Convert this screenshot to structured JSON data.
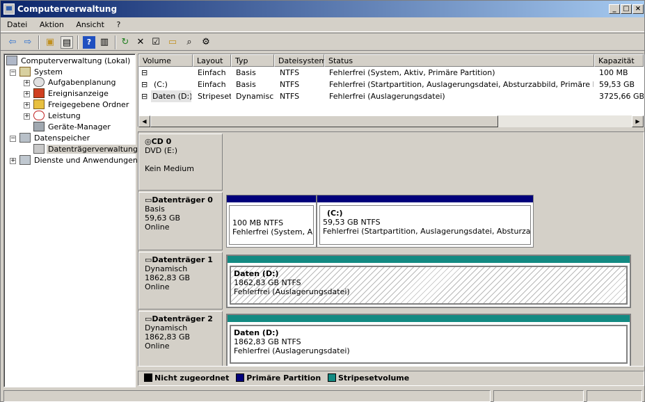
{
  "window": {
    "title": "Computerverwaltung"
  },
  "menu": [
    "Datei",
    "Aktion",
    "Ansicht",
    "?"
  ],
  "tree": {
    "root": "Computerverwaltung (Lokal)",
    "system": "System",
    "aufgaben": "Aufgabenplanung",
    "ereignis": "Ereignisanzeige",
    "freigabe": "Freigegebene Ordner",
    "leistung": "Leistung",
    "geraete": "Geräte-Manager",
    "datenspeicher": "Datenspeicher",
    "datentraeger": "Datenträgerverwaltung",
    "dienste": "Dienste und Anwendungen"
  },
  "columns": [
    "Volume",
    "Layout",
    "Typ",
    "Dateisystem",
    "Status",
    "Kapazität"
  ],
  "volumes": [
    {
      "volume": "",
      "layout": "Einfach",
      "typ": "Basis",
      "fs": "NTFS",
      "status": "Fehlerfrei (System, Aktiv, Primäre Partition)",
      "kap": "100 MB"
    },
    {
      "volume": "(C:)",
      "layout": "Einfach",
      "typ": "Basis",
      "fs": "NTFS",
      "status": "Fehlerfrei (Startpartition, Auslagerungsdatei, Absturzabbild, Primäre Partition)",
      "kap": "59,53 GB"
    },
    {
      "volume": "Daten (D:)",
      "layout": "Stripeset",
      "typ": "Dynamisch",
      "fs": "NTFS",
      "status": "Fehlerfrei (Auslagerungsdatei)",
      "kap": "3725,66 GB"
    }
  ],
  "cd": {
    "name": "CD 0",
    "line1": "DVD (E:)",
    "line2": "Kein Medium"
  },
  "disk0": {
    "name": "Datenträger 0",
    "type": "Basis",
    "size": "59,63 GB",
    "state": "Online",
    "p1": {
      "title": "",
      "size": "100 MB NTFS",
      "status": "Fehlerfrei (System, Aktiv"
    },
    "p2": {
      "title": "(C:)",
      "size": "59,53 GB NTFS",
      "status": "Fehlerfrei (Startpartition, Auslagerungsdatei, Absturzabbild, P"
    }
  },
  "disk1": {
    "name": "Datenträger 1",
    "type": "Dynamisch",
    "size": "1862,83 GB",
    "state": "Online",
    "p1": {
      "title": "Daten  (D:)",
      "size": "1862,83 GB NTFS",
      "status": "Fehlerfrei (Auslagerungsdatei)"
    }
  },
  "disk2": {
    "name": "Datenträger 2",
    "type": "Dynamisch",
    "size": "1862,83 GB",
    "state": "Online",
    "p1": {
      "title": "Daten  (D:)",
      "size": "1862,83 GB NTFS",
      "status": "Fehlerfrei (Auslagerungsdatei)"
    }
  },
  "legend": {
    "unallocated": "Nicht zugeordnet",
    "primary": "Primäre Partition",
    "stripe": "Stripesetvolume",
    "colors": {
      "unallocated": "#000000",
      "primary": "#00007b",
      "stripe": "#138a82"
    }
  }
}
